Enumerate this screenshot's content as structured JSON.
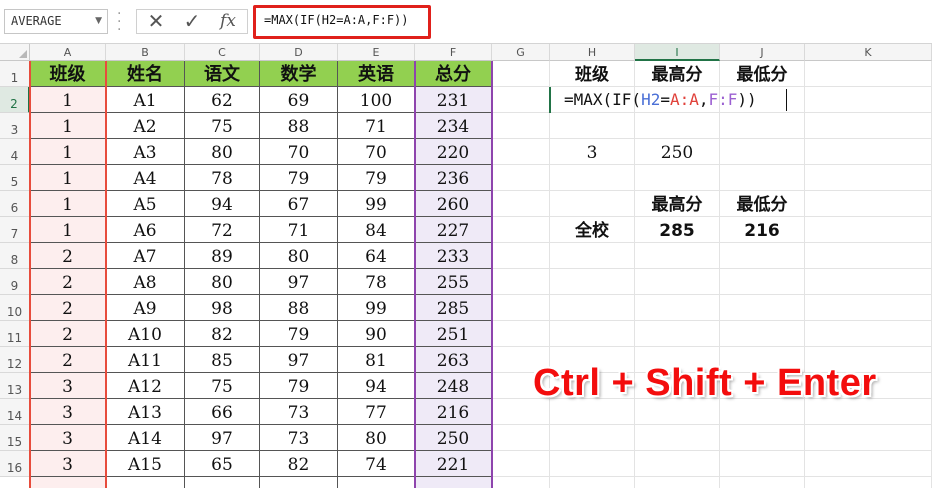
{
  "formula_bar": {
    "name_box": "AVERAGE",
    "cancel_icon": "✕",
    "enter_icon": "✓",
    "fx_label": "fx",
    "formula": "=MAX(IF(H2=A:A,F:F))"
  },
  "columns": [
    "A",
    "B",
    "C",
    "D",
    "E",
    "F",
    "G",
    "H",
    "I",
    "J",
    "K"
  ],
  "selected_column": "I",
  "selected_row": "2",
  "rows": [
    "1",
    "2",
    "3",
    "4",
    "5",
    "6",
    "7",
    "8",
    "9",
    "10",
    "11",
    "12",
    "13",
    "14",
    "15",
    "16"
  ],
  "table": {
    "headers": [
      "班级",
      "姓名",
      "语文",
      "数学",
      "英语",
      "总分"
    ],
    "data": [
      [
        "1",
        "A1",
        "62",
        "69",
        "100",
        "231"
      ],
      [
        "1",
        "A2",
        "75",
        "88",
        "71",
        "234"
      ],
      [
        "1",
        "A3",
        "80",
        "70",
        "70",
        "220"
      ],
      [
        "1",
        "A4",
        "78",
        "79",
        "79",
        "236"
      ],
      [
        "1",
        "A5",
        "94",
        "67",
        "99",
        "260"
      ],
      [
        "1",
        "A6",
        "72",
        "71",
        "84",
        "227"
      ],
      [
        "2",
        "A7",
        "89",
        "80",
        "64",
        "233"
      ],
      [
        "2",
        "A8",
        "80",
        "97",
        "78",
        "255"
      ],
      [
        "2",
        "A9",
        "98",
        "88",
        "99",
        "285"
      ],
      [
        "2",
        "A10",
        "82",
        "79",
        "90",
        "251"
      ],
      [
        "2",
        "A11",
        "85",
        "97",
        "81",
        "263"
      ],
      [
        "3",
        "A12",
        "75",
        "79",
        "94",
        "248"
      ],
      [
        "3",
        "A13",
        "66",
        "73",
        "77",
        "216"
      ],
      [
        "3",
        "A14",
        "97",
        "73",
        "80",
        "250"
      ],
      [
        "3",
        "A15",
        "65",
        "82",
        "74",
        "221"
      ]
    ]
  },
  "summary": {
    "h1": "班级",
    "i1": "最高分",
    "j1": "最低分",
    "h4": "3",
    "i4": "250",
    "i6": "最高分",
    "j6": "最低分",
    "h7": "全校",
    "i7": "285",
    "j7": "216"
  },
  "edit_formula": {
    "p1": "=MAX(IF(",
    "p2": "H2",
    "p3": "=",
    "p4": "A:A",
    "p5": ",",
    "p6": "F:F",
    "p7": "))"
  },
  "annotation": "Ctrl + Shift + Enter",
  "colors": {
    "header_fill": "#92d050",
    "class_col_fill": "#fdeeee",
    "total_col_fill": "#efeaf7",
    "highlight_border": "#e0201b",
    "annotation_text": "#f30d0d",
    "ref_blue": "#4a6fd6",
    "ref_red": "#e0413a",
    "ref_purple": "#9b5fd1"
  }
}
